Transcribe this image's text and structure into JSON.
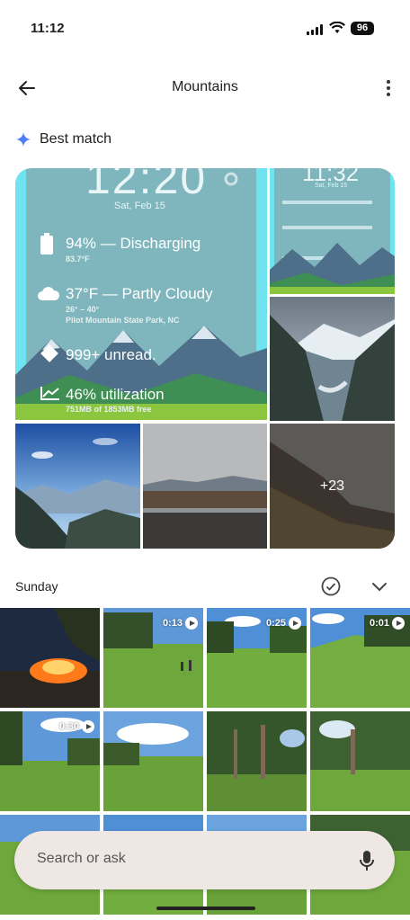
{
  "status_bar": {
    "time": "11:12",
    "battery": "96"
  },
  "app_bar": {
    "title": "Mountains"
  },
  "best_match": {
    "label": "Best match",
    "widget": {
      "clock": "12:20",
      "date": "Sat, Feb 15",
      "battery_line": "94% — Discharging",
      "battery_temp": "83.7°F",
      "weather_line": "37°F — Partly Cloudy",
      "weather_range": "26° – 40°",
      "weather_place": "Pilot Mountain State Park, NC",
      "unread_line": "999+ unread.",
      "storage_line": "46% utilization",
      "storage_detail": "751MB of 1853MB free"
    },
    "small_widget": {
      "clock": "11:32",
      "date": "Sat, Feb 15"
    },
    "more_count": "+23"
  },
  "day_section": {
    "label": "Sunday"
  },
  "photos": [
    {
      "kind": "campfire",
      "duration": ""
    },
    {
      "kind": "meadow-people",
      "duration": "0:13"
    },
    {
      "kind": "meadow-trees",
      "duration": "0:25"
    },
    {
      "kind": "meadow-hill",
      "duration": "0:01"
    },
    {
      "kind": "forest-edge",
      "duration": "0:30"
    },
    {
      "kind": "meadow-clouds",
      "duration": ""
    },
    {
      "kind": "forest-trunks",
      "duration": ""
    },
    {
      "kind": "forest-sunny",
      "duration": ""
    },
    {
      "kind": "meadow-low",
      "duration": ""
    },
    {
      "kind": "meadow-low2",
      "duration": ""
    },
    {
      "kind": "meadow-low3",
      "duration": ""
    },
    {
      "kind": "meadow-low4",
      "duration": ""
    }
  ],
  "search": {
    "placeholder": "Search or ask"
  },
  "icons": {
    "back": "arrow-left-icon",
    "more": "more-vert-icon",
    "sparkle": "sparkle-icon",
    "check": "check-circle-icon",
    "chevron": "chevron-down-icon",
    "mic": "mic-icon"
  },
  "colors": {
    "accent": "#4f7df5",
    "search_bg": "#efe7e3",
    "widget_bg": "#7fb5bd",
    "widget_frame": "#6fe3ef"
  }
}
